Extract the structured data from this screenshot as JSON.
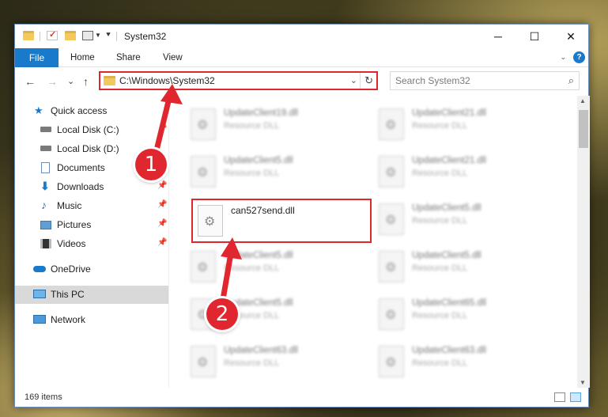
{
  "titlebar": {
    "title": "System32",
    "minimize": "─",
    "maximize": "☐",
    "close": "✕"
  },
  "ribbon": {
    "file": "File",
    "home": "Home",
    "share": "Share",
    "view": "View"
  },
  "navbar": {
    "back": "←",
    "forward": "→",
    "recent": "⌄",
    "up": "↑",
    "address": "C:\\Windows\\System32",
    "refresh": "↻",
    "search_placeholder": "Search System32"
  },
  "sidebar": {
    "items": [
      {
        "label": "Quick access"
      },
      {
        "label": "Local Disk (C:)"
      },
      {
        "label": "Local Disk (D:)"
      },
      {
        "label": "Documents"
      },
      {
        "label": "Downloads"
      },
      {
        "label": "Music"
      },
      {
        "label": "Pictures"
      },
      {
        "label": "Videos"
      },
      {
        "label": "OneDrive"
      },
      {
        "label": "This PC"
      },
      {
        "label": "Network"
      }
    ]
  },
  "files": [
    {
      "name": "UpdateClient19.dll",
      "type": "Resource DLL"
    },
    {
      "name": "UpdateClient21.dll",
      "type": "Resource DLL"
    },
    {
      "name": "UpdateClient5.dll",
      "type": "Resource DLL"
    },
    {
      "name": "UpdateClient21.dll",
      "type": "Resource DLL"
    },
    {
      "name": "can527send.dll",
      "type": ""
    },
    {
      "name": "UpdateClient5.dll",
      "type": "Resource DLL"
    },
    {
      "name": "UpdateClient5.dll",
      "type": "Resource DLL"
    },
    {
      "name": "UpdateClient5.dll",
      "type": "Resource DLL"
    },
    {
      "name": "UpdateClient5.dll",
      "type": "Resource DLL"
    },
    {
      "name": "UpdateClient65.dll",
      "type": "Resource DLL"
    },
    {
      "name": "UpdateClient63.dll",
      "type": "Resource DLL"
    },
    {
      "name": "UpdateClient63.dll",
      "type": "Resource DLL"
    }
  ],
  "status": {
    "items": "169 items"
  },
  "annotations": {
    "step1": "1",
    "step2": "2"
  },
  "colors": {
    "accent": "#1979ca",
    "highlight": "#e0272f",
    "selected": "#d9d9d9"
  }
}
